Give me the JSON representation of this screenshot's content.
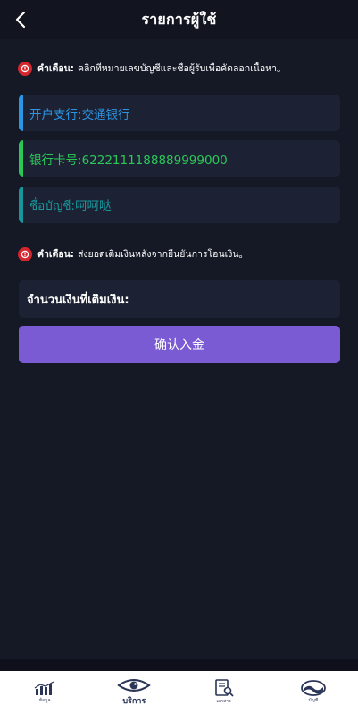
{
  "header": {
    "title": "รายการผู้ใช้"
  },
  "warnings": {
    "copy": {
      "label": "คำเตือน:",
      "text": "คลิกที่หมายเลขบัญชีและชื่อผู้รับเพื่อคัดลอกเนื้อหา。"
    },
    "transfer": {
      "label": "คำเตือน:",
      "text": "ส่งยอดเติมเงินหลังจากยืนยันการโอนเงิน。"
    }
  },
  "bank_info": [
    {
      "label": "开户支行:",
      "value": "交通银行",
      "color": "#2b95e6"
    },
    {
      "label": "银行卡号:",
      "value": "6222111188889999000",
      "color": "#2bc857"
    },
    {
      "label": "ชื่อบัญชี:",
      "value": "呵呵哒",
      "color": "#18969c"
    }
  ],
  "amount": {
    "label": "จำนวนเงินที่เติมเงิน:",
    "value": "",
    "placeholder": ""
  },
  "confirm_button": {
    "label": "确认入金",
    "color": "#7b5bd3"
  },
  "bottom_nav": [
    {
      "label": "ข้อมูล",
      "icon": "chart-icon"
    },
    {
      "label": "บริการ",
      "icon": "eye-icon"
    },
    {
      "label": "เอกสาร",
      "icon": "document-search-icon"
    },
    {
      "label": "บัญชี",
      "icon": "wave-logo-icon"
    }
  ]
}
